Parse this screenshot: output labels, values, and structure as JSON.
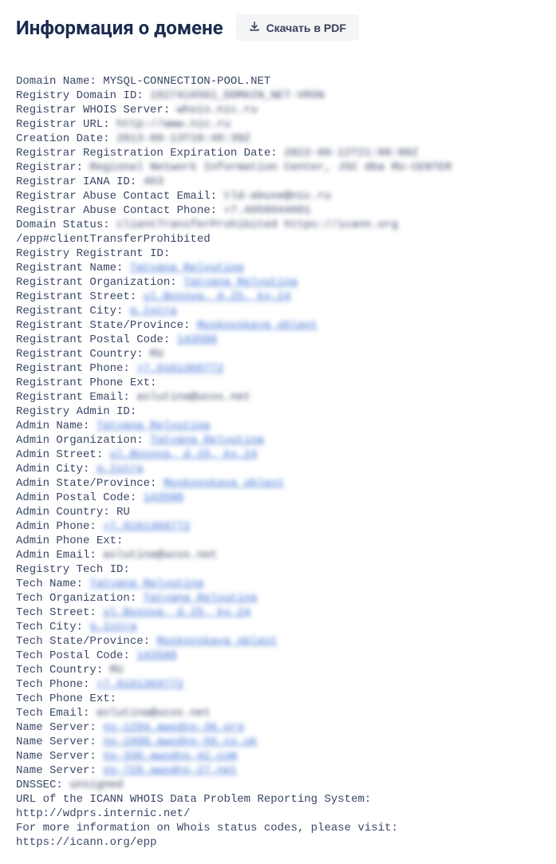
{
  "header": {
    "title": "Информация о домене",
    "download_label": "Скачать в PDF"
  },
  "whois_lines": [
    {
      "label": "Domain Name:",
      "value": "MYSQL-CONNECTION-POOL.NET",
      "link": false,
      "blur": false
    },
    {
      "label": "Registry Domain ID:",
      "value": "1827416561_DOMAIN_NET-VRSN",
      "link": false,
      "blur": true
    },
    {
      "label": "Registrar WHOIS Server:",
      "value": "whois.nic.ru",
      "link": false,
      "blur": true
    },
    {
      "label": "Registrar URL:",
      "value": "http://www.nic.ru",
      "link": false,
      "blur": true
    },
    {
      "label": "Creation Date:",
      "value": "2013-09-13T10:48:30Z",
      "link": false,
      "blur": true
    },
    {
      "label": "Registrar Registration Expiration Date:",
      "value": "2022-09-12T21:00:00Z",
      "link": false,
      "blur": true
    },
    {
      "label": "Registrar:",
      "value": "Regional Network Information Center, JSC dba RU-CENTER",
      "link": false,
      "blur": true
    },
    {
      "label": "Registrar IANA ID:",
      "value": "463",
      "link": false,
      "blur": true
    },
    {
      "label": "Registrar Abuse Contact Email:",
      "value": "tld-abuse@nic.ru",
      "link": false,
      "blur": true
    },
    {
      "label": "Registrar Abuse Contact Phone:",
      "value": "+7.4959944601",
      "link": false,
      "blur": true
    },
    {
      "label": "Domain Status:",
      "value": "clientTransferProhibited https://icann.org",
      "link": false,
      "blur": true
    },
    {
      "label": "/epp#clientTransferProhibited",
      "value": "",
      "link": false,
      "blur": true
    },
    {
      "label": "Registry Registrant ID:",
      "value": "",
      "link": false,
      "blur": false
    },
    {
      "label": "Registrant Name:",
      "value": "Tatyana Relyutina",
      "link": true,
      "blur": true
    },
    {
      "label": "Registrant Organization:",
      "value": "Tatyana Relyutina",
      "link": true,
      "blur": true
    },
    {
      "label": "Registrant Street:",
      "value": "ul.Bosova, d.25, kv.24",
      "link": true,
      "blur": true
    },
    {
      "label": "Registrant City:",
      "value": "g.Istra",
      "link": true,
      "blur": true
    },
    {
      "label": "Registrant State/Province:",
      "value": "Moskovskaya oblast",
      "link": true,
      "blur": true
    },
    {
      "label": "Registrant Postal Code:",
      "value": "143500",
      "link": true,
      "blur": true
    },
    {
      "label": "Registrant Country:",
      "value": "RU",
      "link": false,
      "blur": true
    },
    {
      "label": "Registrant Phone:",
      "value": "+7.9161369772",
      "link": true,
      "blur": true
    },
    {
      "label": "Registrant Phone Ext:",
      "value": "",
      "link": false,
      "blur": false
    },
    {
      "label": "Registrant Email:",
      "value": "aslutina@ucos.net",
      "link": false,
      "blur": true
    },
    {
      "label": "Registry Admin ID:",
      "value": "",
      "link": false,
      "blur": false
    },
    {
      "label": "Admin Name:",
      "value": "Tatyana Relyutina",
      "link": true,
      "blur": true
    },
    {
      "label": "Admin Organization:",
      "value": "Tatyana Relyutina",
      "link": true,
      "blur": true
    },
    {
      "label": "Admin Street:",
      "value": "ul.Bosova, d.25, kv.24",
      "link": true,
      "blur": true
    },
    {
      "label": "Admin City:",
      "value": "g.Istra",
      "link": true,
      "blur": true
    },
    {
      "label": "Admin State/Province:",
      "value": "Moskovskaya oblast",
      "link": true,
      "blur": true
    },
    {
      "label": "Admin Postal Code:",
      "value": "143500",
      "link": true,
      "blur": true
    },
    {
      "label": "Admin Country: RU",
      "value": "",
      "link": false,
      "blur": false
    },
    {
      "label": "Admin Phone:",
      "value": "+7.9161369772",
      "link": true,
      "blur": true
    },
    {
      "label": "Admin Phone Ext:",
      "value": "",
      "link": false,
      "blur": false
    },
    {
      "label": "Admin Email:",
      "value": "aslutina@ucos.net",
      "link": false,
      "blur": true
    },
    {
      "label": "Registry Tech ID:",
      "value": "",
      "link": false,
      "blur": false
    },
    {
      "label": "Tech Name:",
      "value": "Tatyana Relyutina",
      "link": true,
      "blur": true
    },
    {
      "label": "Tech Organization:",
      "value": "Tatyana Relyutina",
      "link": true,
      "blur": true
    },
    {
      "label": "Tech Street:",
      "value": "ul.Bosova, d.25, kv.24",
      "link": true,
      "blur": true
    },
    {
      "label": "Tech City:",
      "value": "g.Istra",
      "link": true,
      "blur": true
    },
    {
      "label": "Tech State/Province:",
      "value": "Moskovskaya oblast",
      "link": true,
      "blur": true
    },
    {
      "label": "Tech Postal Code:",
      "value": "143500",
      "link": true,
      "blur": true
    },
    {
      "label": "Tech Country:",
      "value": "RU",
      "link": false,
      "blur": true
    },
    {
      "label": "Tech Phone:",
      "value": "+7.9161369772",
      "link": true,
      "blur": true
    },
    {
      "label": "Tech Phone Ext:",
      "value": "",
      "link": false,
      "blur": false
    },
    {
      "label": "Tech Email:",
      "value": "aslutina@ucos.net",
      "link": false,
      "blur": true
    },
    {
      "label": "Name Server:",
      "value": "ns-1294.awsdns-36.org",
      "link": true,
      "blur": true
    },
    {
      "label": "Name Server:",
      "value": "ns-1990.awsdns-56.co.uk",
      "link": true,
      "blur": true
    },
    {
      "label": "Name Server:",
      "value": "ns-336.awsdns-42.com",
      "link": true,
      "blur": true
    },
    {
      "label": "Name Server:",
      "value": "ns-729.awsdns-27.net",
      "link": true,
      "blur": true
    },
    {
      "label": "DNSSEC:",
      "value": "unsigned",
      "link": false,
      "blur": true
    },
    {
      "label": "URL of the ICANN WHOIS Data Problem Reporting System:",
      "value": "",
      "link": false,
      "blur": false
    },
    {
      "label": "http://wdprs.internic.net/",
      "value": "",
      "link": false,
      "blur": false
    },
    {
      "label": "For more information on Whois status codes, please visit:",
      "value": "",
      "link": false,
      "blur": false
    },
    {
      "label": "https://icann.org/epp",
      "value": "",
      "link": false,
      "blur": false
    }
  ]
}
